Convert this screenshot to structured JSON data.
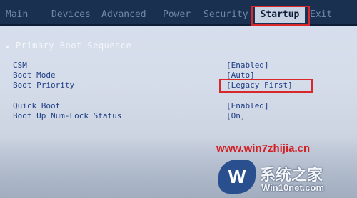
{
  "tabs": [
    {
      "label": "Main",
      "active": false
    },
    {
      "label": "Devices",
      "active": false
    },
    {
      "label": "Advanced",
      "active": false
    },
    {
      "label": "Power",
      "active": false
    },
    {
      "label": "Security",
      "active": false
    },
    {
      "label": "Startup",
      "active": true
    },
    {
      "label": "Exit",
      "active": false
    }
  ],
  "section": {
    "title": "Primary Boot Sequence"
  },
  "settings": [
    {
      "label": "CSM",
      "value": "[Enabled]"
    },
    {
      "label": "Boot Mode",
      "value": "[Auto]"
    },
    {
      "label": "Boot Priority",
      "value": "[Legacy First]"
    },
    {
      "label": "Quick Boot",
      "value": "[Enabled]"
    },
    {
      "label": "Boot Up Num-Lock Status",
      "value": "[On]"
    }
  ],
  "watermark": {
    "url": "www.win7zhijia.cn",
    "logo_name": "系统之家",
    "logo_sub": "Win10net.com",
    "logo_letter": "W"
  },
  "colors": {
    "highlight": "#d9282a",
    "tab_bar": "#1a3050",
    "setting_text": "#1f3f86",
    "background": "#d7e0ef"
  }
}
